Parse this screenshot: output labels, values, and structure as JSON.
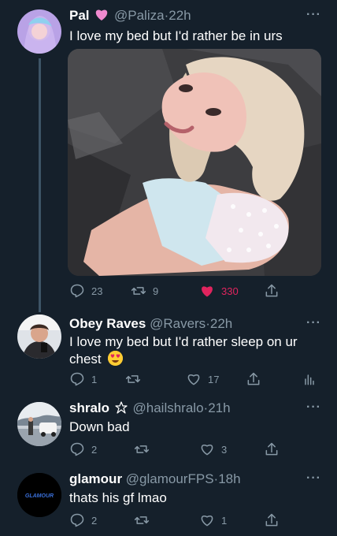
{
  "tweets": [
    {
      "name": "Pal",
      "handle": "@Paliza",
      "dot": "·",
      "time": "22h",
      "text": "I love my bed but I'd rather be in urs",
      "replies": "23",
      "retweets": "9",
      "likes": "330"
    },
    {
      "name": "Obey Raves",
      "handle": "@Ravers",
      "dot": "·",
      "time": "22h",
      "text_line1": "I love my bed but I'd rather sleep on ur",
      "text_line2": "chest",
      "replies": "1",
      "retweets": "",
      "likes": "17"
    },
    {
      "name": "shralo",
      "handle": "@hailshralo",
      "dot": "·",
      "time": "21h",
      "text": "Down bad",
      "replies": "2",
      "retweets": "",
      "likes": "3"
    },
    {
      "name": "glamour",
      "handle": "@glamourFPS",
      "dot": "·",
      "time": "18h",
      "text": "thats his gf lmao",
      "replies": "2",
      "retweets": "",
      "likes": "1",
      "avatar_logo_text": "GLAMOUR"
    }
  ],
  "more_label": "···",
  "colors": {
    "background": "#15202b",
    "secondary_text": "#8899a6",
    "like_active": "#e0245e",
    "thread_line": "#3d5466"
  }
}
